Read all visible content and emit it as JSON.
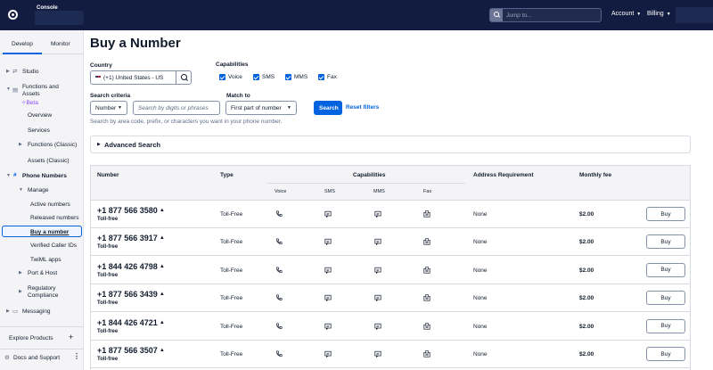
{
  "topbar": {
    "console_label": "Console",
    "search_placeholder": "Jump to...",
    "account_label": "Account",
    "billing_label": "Billing"
  },
  "sidebar": {
    "tabs": [
      "Develop",
      "Monitor"
    ],
    "items": {
      "studio": "Studio",
      "functions_assets": "Functions and Assets",
      "beta": "Beta",
      "overview": "Overview",
      "services": "Services",
      "functions_classic": "Functions (Classic)",
      "assets_classic": "Assets (Classic)",
      "phone_numbers": "Phone Numbers",
      "manage": "Manage",
      "active_numbers": "Active numbers",
      "released_numbers": "Released numbers",
      "buy_number": "Buy a number",
      "verified_caller_ids": "Verified Caller IDs",
      "twiml_apps": "TwiML apps",
      "port_host": "Port & Host",
      "regulatory": "Regulatory Compliance",
      "messaging": "Messaging"
    },
    "explore_products": "Explore Products",
    "docs_support": "Docs and Support"
  },
  "main": {
    "title": "Buy a Number",
    "country_label": "Country",
    "country_value": "(+1) United States - US",
    "capabilities_label": "Capabilities",
    "capabilities": [
      "Voice",
      "SMS",
      "MMS",
      "Fax"
    ],
    "search_criteria_label": "Search criteria",
    "criteria_value": "Number",
    "search_placeholder": "Search by digits or phrases",
    "match_to_label": "Match to",
    "match_value": "First part of number",
    "search_button": "Search",
    "reset_link": "Reset filters",
    "help_text": "Search by area code, prefix, or characters you want in your phone number.",
    "advanced_search": "Advanced Search"
  },
  "table": {
    "headers": {
      "number": "Number",
      "type": "Type",
      "capabilities": "Capabilities",
      "address": "Address Requirement",
      "fee": "Monthly fee"
    },
    "cap_headers": [
      "Voice",
      "SMS",
      "MMS",
      "Fax"
    ],
    "rows": [
      {
        "number": "+1 877 566 3580",
        "sub": "Toll-free",
        "type": "Toll-Free",
        "address": "None",
        "fee": "$2.00",
        "action": "Buy"
      },
      {
        "number": "+1 877 566 3917",
        "sub": "Toll-free",
        "type": "Toll-Free",
        "address": "None",
        "fee": "$2.00",
        "action": "Buy"
      },
      {
        "number": "+1 844 426 4798",
        "sub": "Toll-free",
        "type": "Toll-Free",
        "address": "None",
        "fee": "$2.00",
        "action": "Buy"
      },
      {
        "number": "+1 877 566 3439",
        "sub": "Toll-free",
        "type": "Toll-Free",
        "address": "None",
        "fee": "$2.00",
        "action": "Buy"
      },
      {
        "number": "+1 844 426 4721",
        "sub": "Toll-free",
        "type": "Toll-Free",
        "address": "None",
        "fee": "$2.00",
        "action": "Buy"
      },
      {
        "number": "+1 877 566 3507",
        "sub": "Toll-free",
        "type": "Toll-Free",
        "address": "None",
        "fee": "$2.00",
        "action": "Buy"
      }
    ]
  },
  "colors": {
    "topbar": "#121c40",
    "accent": "#0263e0",
    "sidebar_bg": "#f4f4f6"
  }
}
